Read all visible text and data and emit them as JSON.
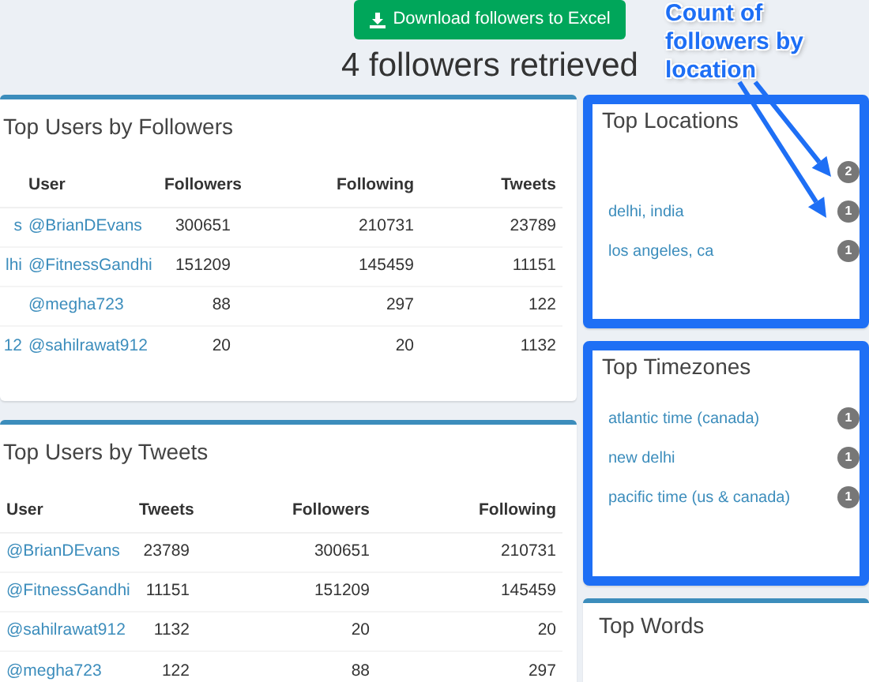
{
  "download_button": "Download followers to Excel",
  "heading": "4 followers retrieved",
  "top_users_by_followers": {
    "title": "Top Users by Followers",
    "columns": [
      "User",
      "Followers",
      "Following",
      "Tweets"
    ],
    "rows": [
      {
        "column_1": "s",
        "user": "@BrianDEvans",
        "followers": "300651",
        "following": "210731",
        "tweets": "23789"
      },
      {
        "column_1": "lhi",
        "user": "@FitnessGandhi",
        "followers": "151209",
        "following": "145459",
        "tweets": "11151"
      },
      {
        "user": "@megha723",
        "followers": "88",
        "following": "297",
        "tweets": "122"
      },
      {
        "column_1": "12",
        "user": "@sahilrawat912",
        "followers": "20",
        "following": "20",
        "tweets": "1132"
      }
    ]
  },
  "top_users_by_tweets": {
    "title": "Top Users by Tweets",
    "columns": [
      "User",
      "Tweets",
      "Followers",
      "Following"
    ],
    "rows": [
      {
        "user": "@BrianDEvans",
        "tweets": "23789",
        "followers": "300651",
        "following": "210731"
      },
      {
        "user": "@FitnessGandhi",
        "tweets": "11151",
        "followers": "151209",
        "following": "145459"
      },
      {
        "user": "@sahilrawat912",
        "tweets": "1132",
        "followers": "20",
        "following": "20"
      },
      {
        "user": "@megha723",
        "tweets": "122",
        "followers": "88",
        "following": "297"
      }
    ]
  },
  "top_locations": {
    "title": "Top Locations",
    "highlighted": true,
    "items": [
      {
        "count": "2"
      },
      {
        "label": "delhi, india",
        "count": "1"
      },
      {
        "label": "los angeles, ca",
        "count": "1"
      }
    ]
  },
  "top_timezones": {
    "title": "Top Timezones",
    "highlighted": true,
    "items": [
      {
        "label": "atlantic time (canada)",
        "count": "1"
      },
      {
        "label": "new delhi",
        "count": "1"
      },
      {
        "label": "pacific time (us & canada)",
        "count": "1"
      }
    ]
  },
  "top_words": {
    "title": "Top Words",
    "highlighted": false
  },
  "annotation": {
    "text": "Count of followers by location"
  }
}
